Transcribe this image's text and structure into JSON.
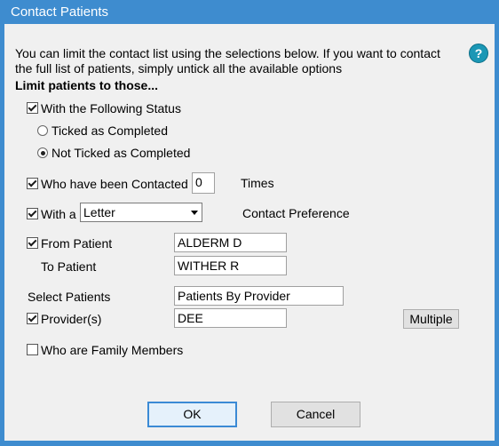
{
  "window": {
    "title": "Contact Patients"
  },
  "intro": {
    "line1": "You can limit the contact list using the selections below. If you want to contact",
    "line2": "the full list of patients, simply untick all the available options",
    "heading": "Limit patients to those..."
  },
  "help": {
    "glyph": "?"
  },
  "status": {
    "label": "With the Following Status",
    "checked": true,
    "options": [
      {
        "label": "Ticked as Completed",
        "selected": false
      },
      {
        "label": "Not Ticked as Completed",
        "selected": true
      }
    ]
  },
  "contacted": {
    "label": "Who have been Contacted",
    "checked": true,
    "value": "0",
    "suffix": "Times"
  },
  "preference": {
    "label": "With a",
    "checked": true,
    "selected": "Letter",
    "suffix": "Contact Preference"
  },
  "from_patient": {
    "label": "From Patient",
    "checked": true,
    "value": "ALDERM D"
  },
  "to_patient": {
    "label": "To Patient",
    "value": "WITHER R"
  },
  "select_patients": {
    "label": "Select Patients",
    "value": "Patients By Provider"
  },
  "providers": {
    "label": "Provider(s)",
    "checked": true,
    "value": "DEE",
    "button": "Multiple"
  },
  "family": {
    "label": "Who are Family Members",
    "checked": false
  },
  "footer": {
    "ok": "OK",
    "cancel": "Cancel"
  }
}
